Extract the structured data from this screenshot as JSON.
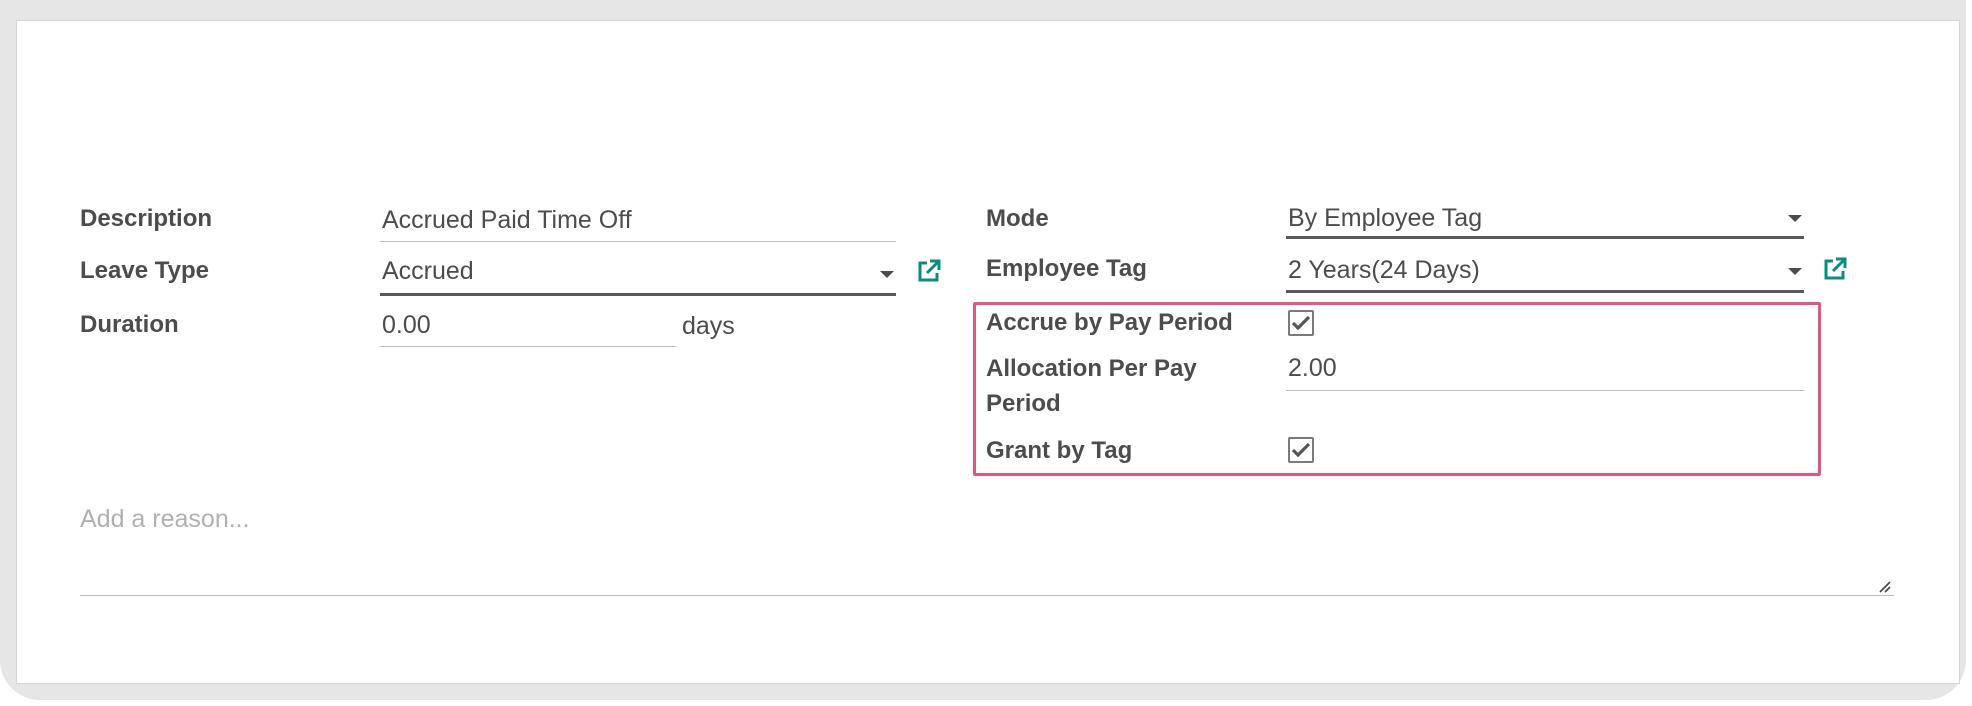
{
  "left_column": {
    "description": {
      "label": "Description",
      "value": "Accrued Paid Time Off"
    },
    "leave_type": {
      "label": "Leave Type",
      "value": "Accrued"
    },
    "duration": {
      "label": "Duration",
      "value": "0.00",
      "unit": "days"
    }
  },
  "right_column": {
    "mode": {
      "label": "Mode",
      "value": "By Employee Tag"
    },
    "employee_tag": {
      "label": "Employee Tag",
      "value": "2 Years(24 Days)"
    },
    "accrue_by_pay_period": {
      "label": "Accrue by Pay Period",
      "checked": true
    },
    "allocation_per_pay_period": {
      "label": "Allocation Per Pay Period",
      "value": "2.00"
    },
    "grant_by_tag": {
      "label": "Grant by Tag",
      "checked": true
    }
  },
  "reason": {
    "placeholder": "Add a reason..."
  },
  "colors": {
    "highlight_border": "#e0587e",
    "external_link_icon": "#0b8c7d",
    "text": "#4c4c4c",
    "placeholder": "#b0b0b0"
  },
  "icons": {
    "leave_type_link": "external-link-icon",
    "employee_tag_link": "external-link-icon",
    "checkbox_check": "check-icon",
    "dropdown": "caret-down-icon",
    "resize": "resize-handle-icon"
  }
}
